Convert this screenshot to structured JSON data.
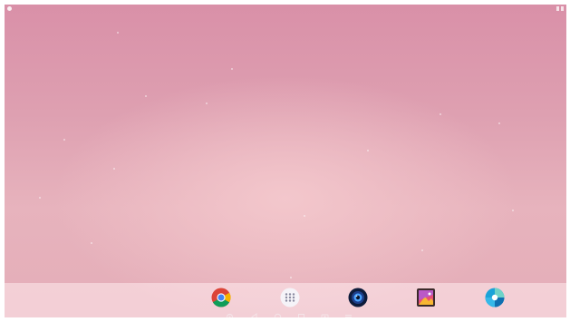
{
  "status_bar": {
    "left_icon": "notification-dot-icon",
    "right_icons": [
      "wifi-icon",
      "battery-icon"
    ]
  },
  "wallpaper": {
    "colors": [
      "#d990a8",
      "#dea0b1",
      "#f3c7cc",
      "#e4adb8"
    ]
  },
  "dock": {
    "apps": [
      {
        "icon": "chrome-icon"
      },
      {
        "icon": "app-drawer-icon"
      },
      {
        "icon": "camera-icon"
      },
      {
        "icon": "gallery-icon"
      },
      {
        "icon": "browser-icon"
      }
    ]
  },
  "nav_bar": {
    "buttons": [
      {
        "icon": "settings-icon"
      },
      {
        "icon": "back-icon"
      },
      {
        "icon": "home-icon"
      },
      {
        "icon": "recents-icon"
      },
      {
        "icon": "screenshot-icon"
      },
      {
        "icon": "menu-icon"
      }
    ]
  }
}
